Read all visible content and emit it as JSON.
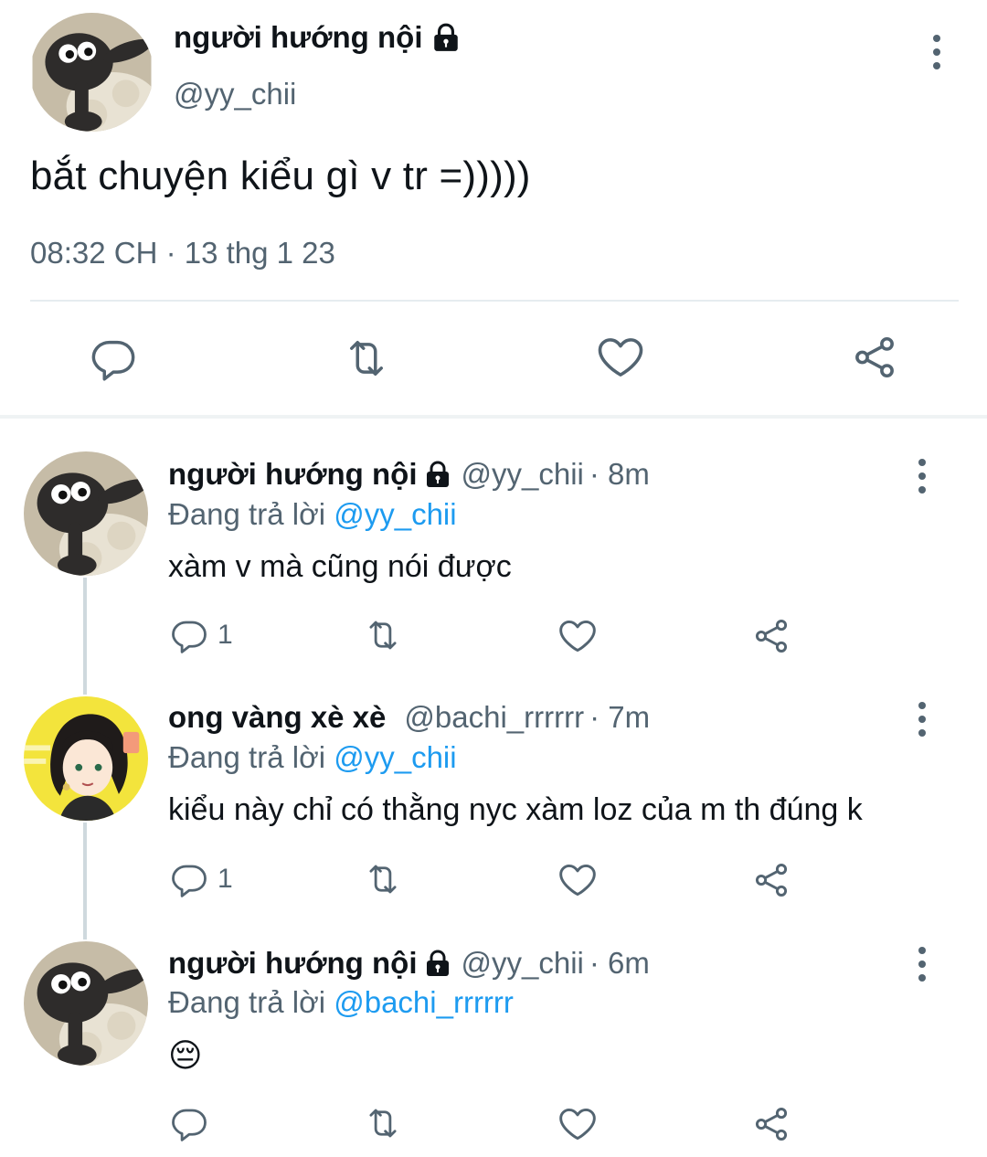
{
  "main_tweet": {
    "display_name": "người hướng nội",
    "handle": "@yy_chii",
    "text": "bắt chuyện kiểu gì v tr =)))))",
    "timestamp": "08:32 CH · 13 thg 1 23"
  },
  "replies": [
    {
      "display_name": "người hướng nội",
      "handle": "@yy_chii",
      "time": "· 8m",
      "replying_prefix": "Đang trả lời",
      "replying_to": "@yy_chii",
      "text": "xàm v mà cũng nói được",
      "reply_count": "1"
    },
    {
      "display_name": "ong vàng xè xè",
      "handle": "@bachi_rrrrrr",
      "time": "· 7m",
      "replying_prefix": "Đang trả lời",
      "replying_to": "@yy_chii",
      "text": "kiểu này chỉ có thằng nyc xàm loz của m th đúng k",
      "reply_count": "1"
    },
    {
      "display_name": "người hướng nội",
      "handle": "@yy_chii",
      "time": "· 6m",
      "replying_prefix": "Đang trả lời",
      "replying_to": "@bachi_rrrrrr",
      "text": "😔",
      "reply_count": ""
    }
  ],
  "colors": {
    "text": "#0f1419",
    "muted": "#536471",
    "link": "#1d9bf0",
    "divider": "#e6ecf0",
    "thread_line": "#cfd9de"
  },
  "icons": [
    "lock-icon",
    "more-icon",
    "reply-icon",
    "retweet-icon",
    "like-icon",
    "share-icon"
  ]
}
